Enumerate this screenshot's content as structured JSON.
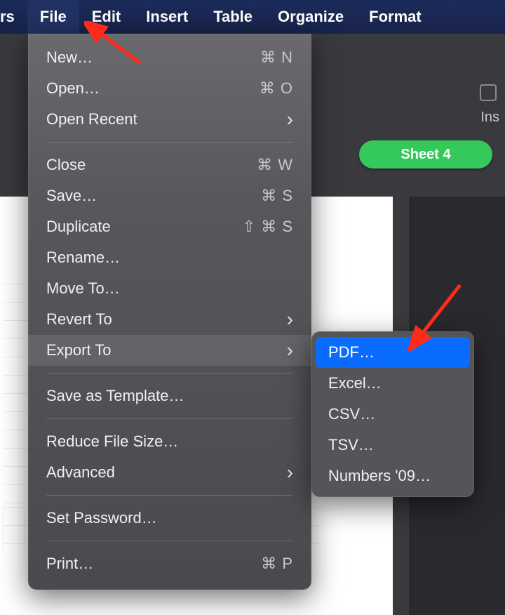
{
  "menubar": {
    "appname_partial": "rs",
    "items": [
      "File",
      "Edit",
      "Insert",
      "Table",
      "Organize",
      "Format"
    ],
    "selected_index": 0
  },
  "chrome": {
    "insert_hint_partial": "Ins"
  },
  "sheet_tab": {
    "label": "Sheet 4"
  },
  "file_menu": {
    "groups": [
      [
        {
          "label": "New…",
          "shortcut": "⌘ N",
          "submenu": false
        },
        {
          "label": "Open…",
          "shortcut": "⌘ O",
          "submenu": false
        },
        {
          "label": "Open Recent",
          "shortcut": "",
          "submenu": true
        }
      ],
      [
        {
          "label": "Close",
          "shortcut": "⌘ W",
          "submenu": false
        },
        {
          "label": "Save…",
          "shortcut": "⌘ S",
          "submenu": false
        },
        {
          "label": "Duplicate",
          "shortcut": "⇧ ⌘ S",
          "submenu": false
        },
        {
          "label": "Rename…",
          "shortcut": "",
          "submenu": false
        },
        {
          "label": "Move To…",
          "shortcut": "",
          "submenu": false
        },
        {
          "label": "Revert To",
          "shortcut": "",
          "submenu": true
        },
        {
          "label": "Export To",
          "shortcut": "",
          "submenu": true,
          "hover": true
        }
      ],
      [
        {
          "label": "Save as Template…",
          "shortcut": "",
          "submenu": false
        }
      ],
      [
        {
          "label": "Reduce File Size…",
          "shortcut": "",
          "submenu": false
        },
        {
          "label": "Advanced",
          "shortcut": "",
          "submenu": true
        }
      ],
      [
        {
          "label": "Set Password…",
          "shortcut": "",
          "submenu": false
        }
      ],
      [
        {
          "label": "Print…",
          "shortcut": "⌘ P",
          "submenu": false
        }
      ]
    ]
  },
  "export_submenu": {
    "items": [
      {
        "label": "PDF…",
        "selected": true
      },
      {
        "label": "Excel…",
        "selected": false
      },
      {
        "label": "CSV…",
        "selected": false
      },
      {
        "label": "TSV…",
        "selected": false
      },
      {
        "label": "Numbers '09…",
        "selected": false
      }
    ]
  },
  "annotations": {
    "arrow1": {
      "points_to": "menubar-item-file"
    },
    "arrow2": {
      "points_to": "submenu-item-pdf"
    }
  }
}
